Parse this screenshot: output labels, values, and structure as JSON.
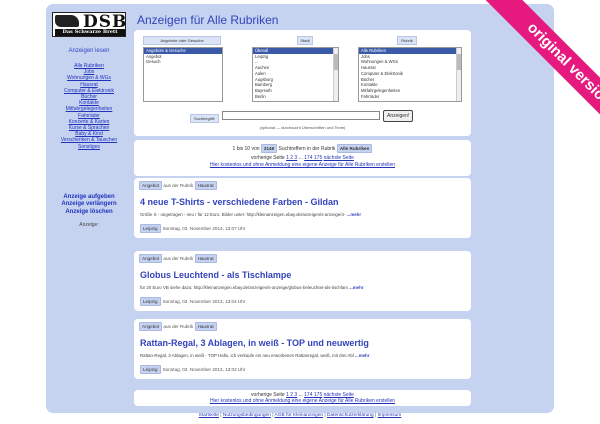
{
  "logo": {
    "big": "DSB",
    "small": "Das Schwarze Brett"
  },
  "sidebar": {
    "heading": "Anzeigen lesen",
    "nav": [
      "Alle Rubriken",
      "Jobs",
      "Wohnungen & WGs",
      "Hausrat",
      "Computer & Elektronik",
      "Bücher",
      "Kontakte",
      "Mitfahrgelegenheiten",
      "Fahrräder",
      "Konzerte & Karten",
      "Kurse & Sprachen",
      "Baby & Kind",
      "Verschenken & Tauschen",
      "Sonstiges"
    ],
    "actions": [
      "Anzeige aufgeben",
      "Anzeige verlängern",
      "Anzeige löschen"
    ],
    "small": "Anzeige:"
  },
  "page_title": "Anzeigen für Alle Rubriken",
  "search": {
    "col1_header": "Angebote oder Gesuche",
    "col1_items": [
      "Angebote & Gesuche",
      "Angebot",
      "Gesuch"
    ],
    "col2_header": "Stadt",
    "col2_items": [
      "Überall",
      "Leipzig",
      "...",
      "Aachen",
      "Aalen",
      "Augsburg",
      "Bamberg",
      "Bayreuth",
      "Berlin"
    ],
    "col3_header": "Rubrik",
    "col3_items": [
      "Alle Rubriken",
      "Jobs",
      "Wohnungen & WGs",
      "Hausrat",
      "Computer & Elektronik",
      "Bücher",
      "Kontakte",
      "Mitfahrgelegenheiten",
      "Fahrräder"
    ],
    "label": "Suchbegriff:",
    "button": "Anzeigen!",
    "note": "(optional — durchsucht Überschriften und Texte)"
  },
  "results": {
    "prefix": "1 bis 10 von",
    "count": "3149",
    "middle": "Suchtreffern in der Rubrik",
    "rubrik": "Alle Rubriken",
    "prev": "vorherige Seite",
    "pages": "1 2 3",
    "ellipsis": "...",
    "far_pages": "174 175",
    "next": "nächste Seite",
    "cta": "Hier kostenlos und ohne Anmeldung eine eigene Anzeige für Alle Rubriken erstellen"
  },
  "ads": [
    {
      "type": "Angebot",
      "from": "aus der Rubrik",
      "rubrik": "Hausrat",
      "title": "4 neue T-Shirts - verschiedene Farben - Gildan",
      "text": "Größe S - ungetragen - neu ! für 12 Euro. Bilder unter: http://kleinanzeigen.ebay.de/anzeigen/s-anzeige/4-",
      "more": "...mehr",
      "city": "Leipzig",
      "date": "Sonntag, 03. November 2013, 13:07 Uhr"
    },
    {
      "type": "Angebot",
      "from": "aus der Rubrik",
      "rubrik": "Hausrat",
      "title": "Globus Leuchtend - als Tischlampe",
      "text": "für 20 Euro VB siehe dazu: http://kleinanzeigen.ebay.de/anzeigen/s-anzeige/globus-beleuchtet-als-tischlam",
      "more": "...mehr",
      "city": "Leipzig",
      "date": "Sonntag, 03. November 2013, 13:04 Uhr"
    },
    {
      "type": "Angebot",
      "from": "aus der Rubrik",
      "rubrik": "Hausrat",
      "title": "Rattan-Regal, 3 Ablagen, in weiß - TOP und neuwertig",
      "text": "Rattan-Regal, 3 Ablagen, in weiß - TOP Hallo, ich verkaufe ein neu erworbenes Rattanregal, weiß, mit drei Abl",
      "more": "...mehr",
      "city": "Leipzig",
      "date": "Sonntag, 03. November 2013, 13:02 Uhr"
    }
  ],
  "footer": {
    "links": [
      "Startseite",
      "Nutzungsbedingungen",
      "AGB für Kleinanzeigen",
      "Datenschutzerklärung",
      "Impressum"
    ],
    "sep": "|"
  },
  "ribbon": {
    "text": "original version",
    "color": "#e5197e"
  }
}
